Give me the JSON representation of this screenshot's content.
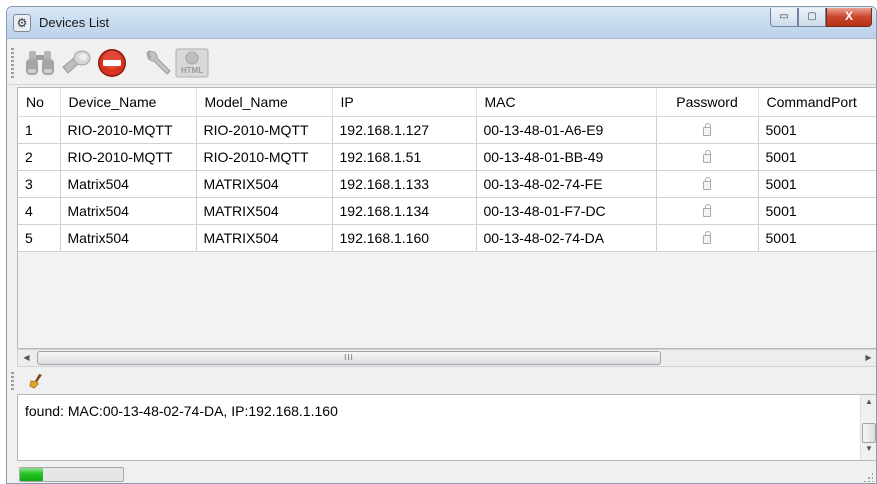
{
  "window": {
    "title": "Devices List",
    "controls": {
      "minimize": "▭",
      "maximize": "▢",
      "close": "X"
    }
  },
  "toolbar": {
    "buttons": [
      {
        "icon": "binoculars-icon",
        "enabled": false
      },
      {
        "icon": "flashlight-icon",
        "enabled": false
      },
      {
        "icon": "stop-icon",
        "enabled": true
      },
      {
        "icon": "wrench-icon",
        "enabled": false
      },
      {
        "icon": "html-icon",
        "label": "HTML",
        "enabled": false
      }
    ]
  },
  "devices": {
    "columns": [
      "No",
      "Device_Name",
      "Model_Name",
      "IP",
      "MAC",
      "Password",
      "CommandPort"
    ],
    "rows": [
      {
        "no": "1",
        "device_name": "RIO-2010-MQTT",
        "model_name": "RIO-2010-MQTT",
        "ip": "192.168.1.127",
        "mac": "00-13-48-01-A6-E9",
        "port": "5001"
      },
      {
        "no": "2",
        "device_name": "RIO-2010-MQTT",
        "model_name": "RIO-2010-MQTT",
        "ip": "192.168.1.51",
        "mac": "00-13-48-01-BB-49",
        "port": "5001"
      },
      {
        "no": "3",
        "device_name": "Matrix504",
        "model_name": "MATRIX504",
        "ip": "192.168.1.133",
        "mac": "00-13-48-02-74-FE",
        "port": "5001"
      },
      {
        "no": "4",
        "device_name": "Matrix504",
        "model_name": "MATRIX504",
        "ip": "192.168.1.134",
        "mac": "00-13-48-01-F7-DC",
        "port": "5001"
      },
      {
        "no": "5",
        "device_name": "Matrix504",
        "model_name": "MATRIX504",
        "ip": "192.168.1.160",
        "mac": "00-13-48-02-74-DA",
        "port": "5001"
      }
    ]
  },
  "scrollbar": {
    "thumb_grip": "III"
  },
  "log": {
    "text": "found: MAC:00-13-48-02-74-DA, IP:192.168.1.160"
  },
  "status": {
    "progress_percent": 22,
    "progress_color": "#22c322"
  }
}
